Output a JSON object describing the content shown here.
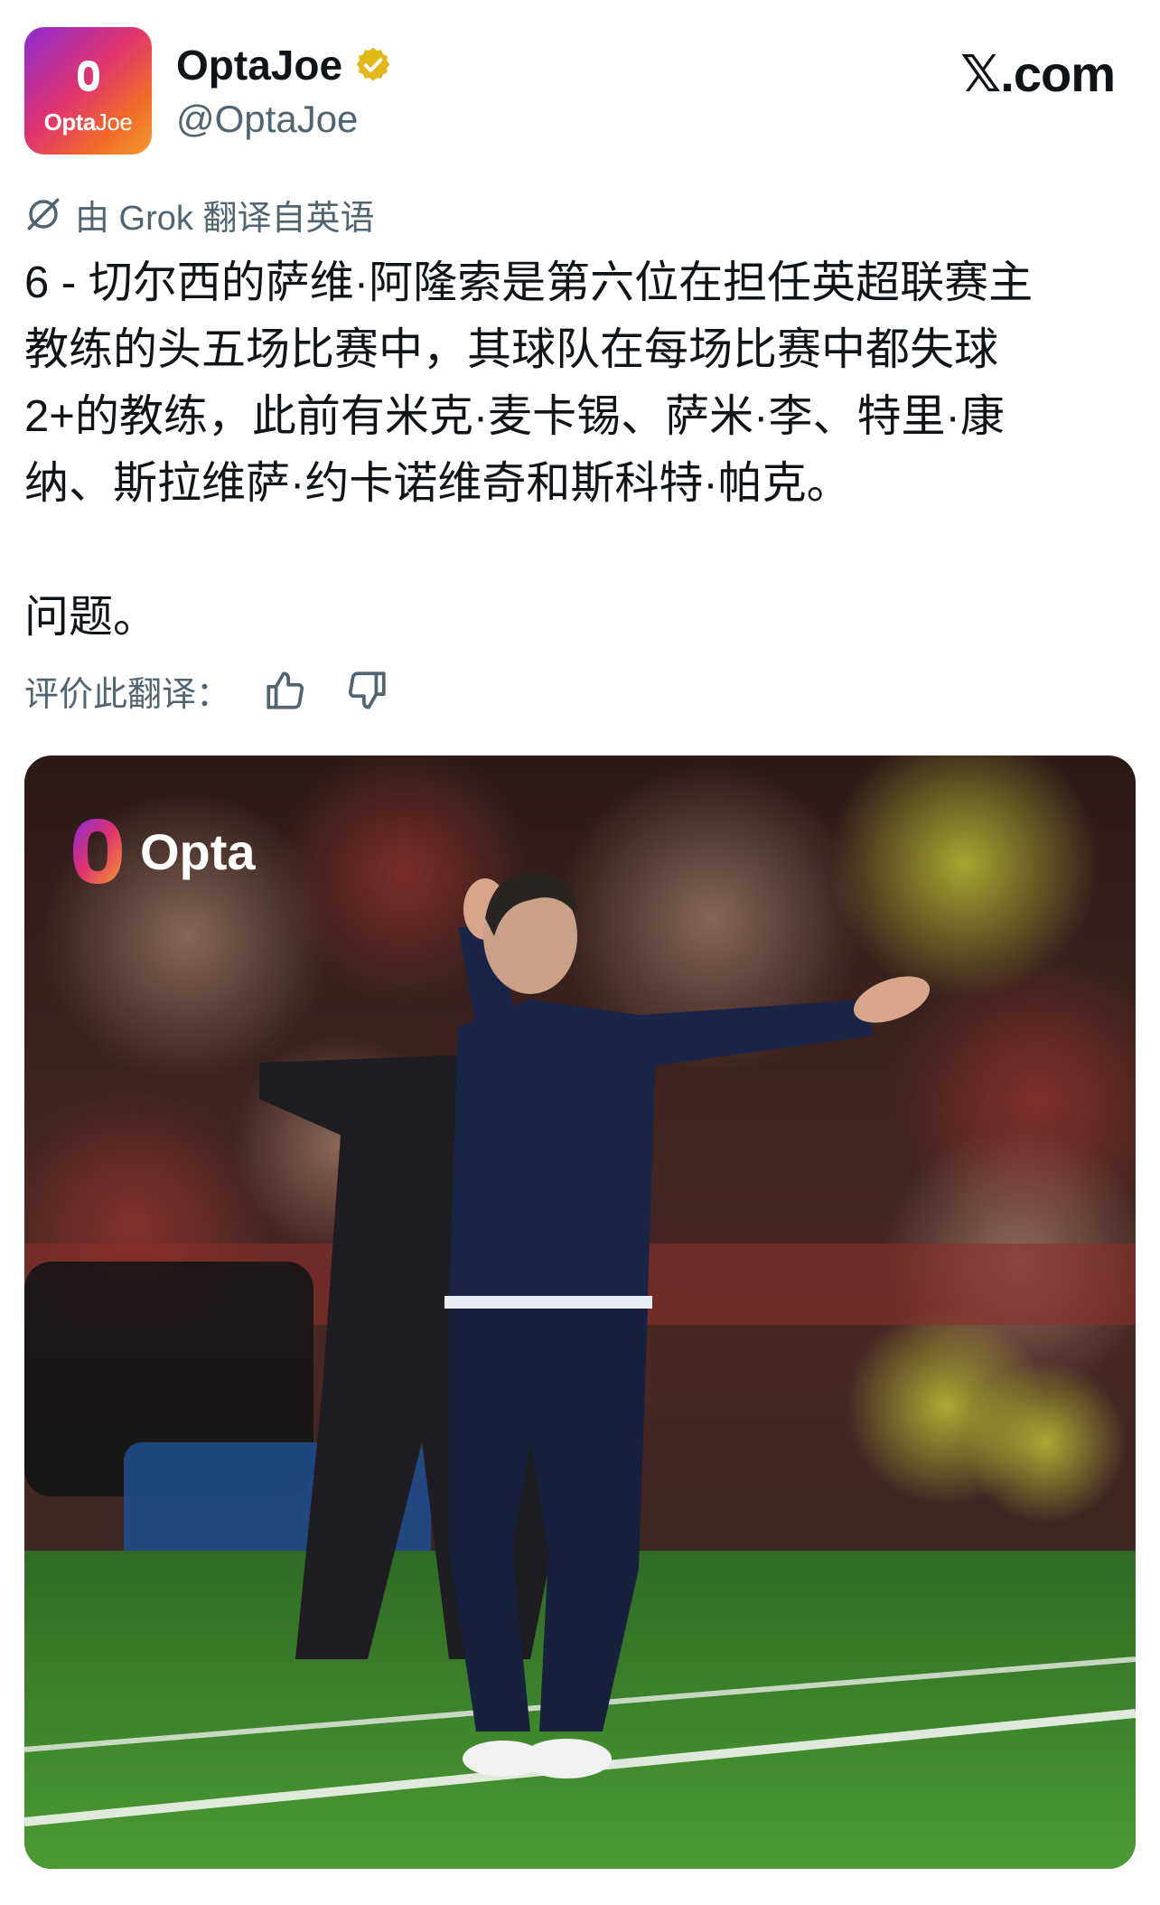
{
  "author": {
    "display_name": "OptaJoe",
    "handle": "@OptaJoe",
    "verified_icon": "verified-badge-gold",
    "avatar": {
      "text_bold": "Opta",
      "text_light": "Joe"
    }
  },
  "site": {
    "logo_text": "𝕏.com"
  },
  "translation": {
    "note": "由 Grok 翻译自英语",
    "icon": "grok-icon"
  },
  "tweet": {
    "text": "6 - 切尔西的萨维·阿隆索是第六位在担任英超联赛主\n教练的头五场比赛中，其球队在每场比赛中都失球\n2+的教练，此前有米克·麦卡锡、萨米·李、特里·康\n纳、斯拉维萨·约卡诺维奇和斯科特·帕克。\n\n问题。"
  },
  "rate": {
    "label": "评价此翻译：",
    "like_icon": "thumbs-up-icon",
    "dislike_icon": "thumbs-down-icon"
  },
  "media": {
    "watermark": "Opta",
    "description_icon": "photo-coach-on-touchline"
  },
  "colors": {
    "text_primary": "#0f1419",
    "text_secondary": "#536471",
    "verified_gold": "#e2b719",
    "pitch_green": "#3f8a2c"
  }
}
